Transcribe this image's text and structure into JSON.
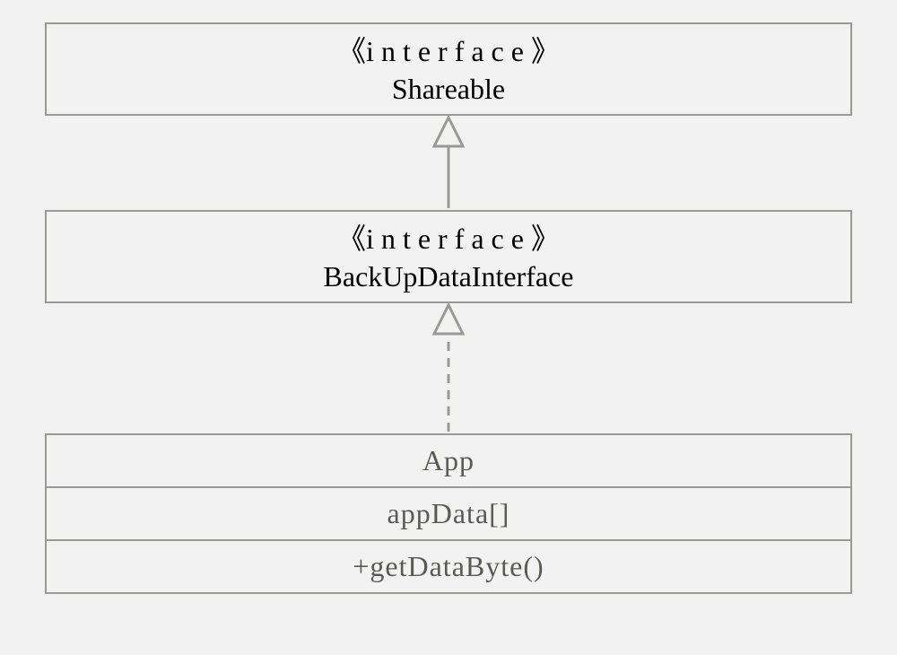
{
  "diagram": {
    "shareable": {
      "stereotype": "《interface》",
      "name": "Shareable"
    },
    "backup": {
      "stereotype": "《interface》",
      "name": "BackUpDataInterface"
    },
    "app": {
      "name": "App",
      "attribute": "appData[]",
      "operation": "+getDataByte()"
    }
  }
}
